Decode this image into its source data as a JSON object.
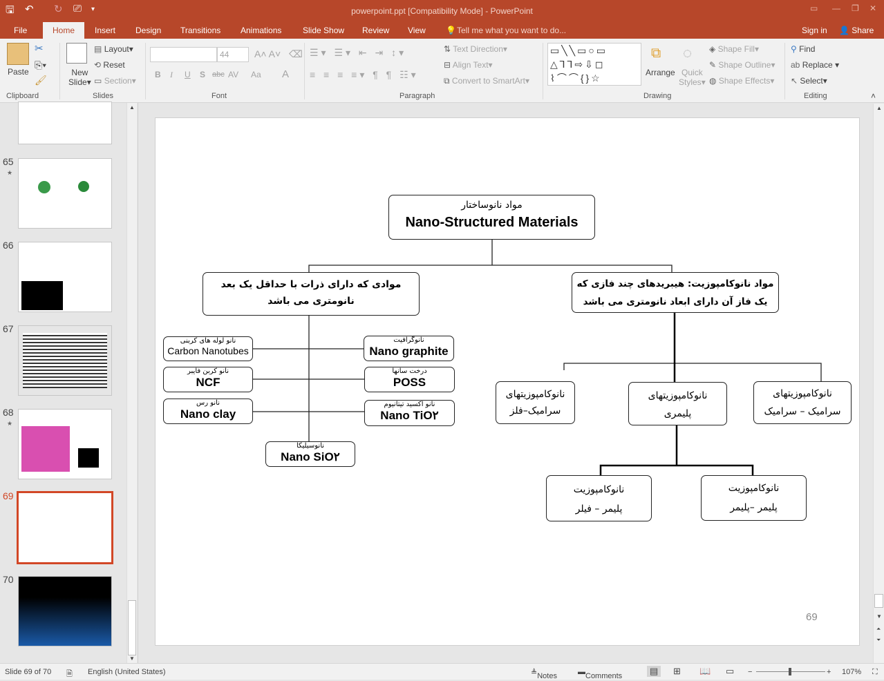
{
  "window": {
    "title": "powerpoint.ppt [Compatibility Mode] - PowerPoint"
  },
  "tabs": [
    "File",
    "Home",
    "Insert",
    "Design",
    "Transitions",
    "Animations",
    "Slide Show",
    "Review",
    "View"
  ],
  "tell_me": "Tell me what you want to do...",
  "sign_in": "Sign in",
  "share": "Share",
  "ribbon": {
    "clipboard": {
      "paste": "Paste",
      "label": "Clipboard"
    },
    "slides": {
      "new_slide_1": "New",
      "new_slide_2": "Slide",
      "layout": "Layout",
      "reset": "Reset",
      "section": "Section",
      "label": "Slides"
    },
    "font": {
      "font_name": "",
      "font_size": "44",
      "bold": "B",
      "italic": "I",
      "underline": "U",
      "shadow": "S",
      "strike": "abc",
      "spacing": "AV",
      "case": "Aa",
      "color": "A",
      "label": "Font"
    },
    "paragraph": {
      "text_direction": "Text Direction",
      "align_text": "Align Text",
      "smartart": "Convert to SmartArt",
      "label": "Paragraph"
    },
    "drawing": {
      "arrange": "Arrange",
      "quick_styles_1": "Quick",
      "quick_styles_2": "Styles",
      "shape_fill": "Shape Fill",
      "shape_outline": "Shape Outline",
      "shape_effects": "Shape Effects",
      "label": "Drawing"
    },
    "editing": {
      "find": "Find",
      "replace": "Replace",
      "select": "Select",
      "label": "Editing"
    }
  },
  "thumbnails": [
    {
      "num": "65",
      "star": true
    },
    {
      "num": "66",
      "star": false
    },
    {
      "num": "67",
      "star": false
    },
    {
      "num": "68",
      "star": true
    },
    {
      "num": "69",
      "star": false,
      "selected": true
    },
    {
      "num": "70",
      "star": false
    }
  ],
  "slide": {
    "page_number": "69",
    "root": {
      "fa": "مواد نانوساختار",
      "en": "Nano-Structured Materials"
    },
    "left": {
      "fa": "موادی که دارای ذرات با حداقل یک بعد نانومتری می باشد"
    },
    "right": {
      "fa": "مواد نانوکامپوزیت: هیبریدهای چند فازی که یک فاز آن دارای ابعاد نانومتری می باشد"
    },
    "nano_items": [
      {
        "fa": "نانو لوله های کربنی",
        "en": "Carbon Nanotubes"
      },
      {
        "fa": "نانو کربن فایبر",
        "en": "NCF"
      },
      {
        "fa": "نانو رس",
        "en": "Nano clay"
      },
      {
        "fa": "نانوگرافیت",
        "en": "Nano graphite"
      },
      {
        "fa": "درخت سانها",
        "en": "POSS"
      },
      {
        "fa": "نانو اکسید تیتانیوم",
        "en": "Nano TiO۲"
      },
      {
        "fa": "نانوسیلیکا",
        "en": "Nano SiO۲"
      }
    ],
    "composites": [
      {
        "line1": "نانوکامپوزیتهای",
        "line2": "سرامیک–فلز"
      },
      {
        "line1": "نانوکامپوزیتهای",
        "line2": "پلیمری"
      },
      {
        "line1": "نانوکامپوزیتهای",
        "line2": "سرامیک – سرامیک"
      },
      {
        "line1": "نانوکامپوزیت",
        "line2": "پلیمر – فیلر"
      },
      {
        "line1": "نانوکامپوزیت",
        "line2": "پلیمر –پلیمر"
      }
    ]
  },
  "status": {
    "slide_of": "Slide 69 of 70",
    "language": "English (United States)",
    "notes": "Notes",
    "comments": "Comments",
    "zoom": "107%"
  },
  "colors": {
    "accent": "#b7472a",
    "selected_thumb": "#d24726"
  }
}
